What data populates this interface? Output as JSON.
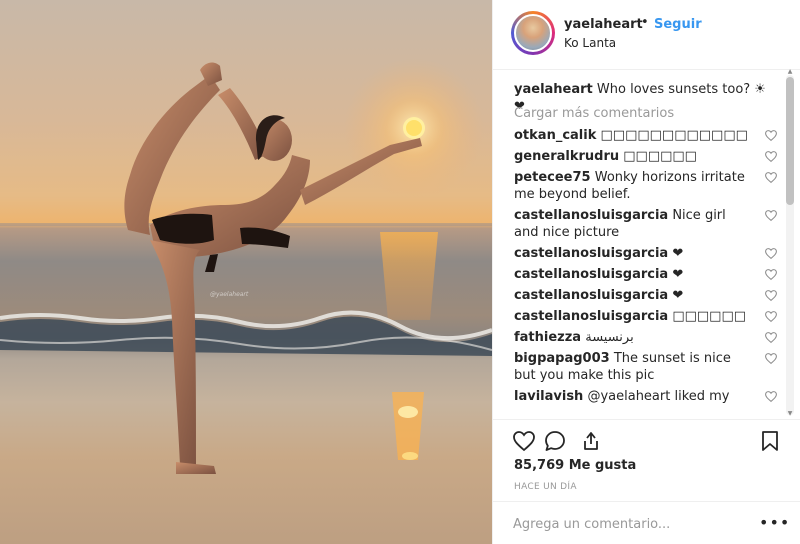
{
  "post": {
    "username": "yaelaheart",
    "follow_label": "Seguir",
    "separator": "•",
    "location": "Ko Lanta",
    "watermark": "@yaelaheart"
  },
  "caption": {
    "username": "yaelaheart",
    "text": "Who loves sunsets too? ☀ ❤"
  },
  "load_more_label": "Cargar más comentarios",
  "comments": [
    {
      "user": "otkan_calik",
      "text": "□□□□□□□□□□□□"
    },
    {
      "user": "generalkrudru",
      "text": "□□□□□□"
    },
    {
      "user": "petecee75",
      "text": "Wonky horizons irritate me beyond belief."
    },
    {
      "user": "castellanosluisgarcia",
      "text": "Nice girl and nice picture"
    },
    {
      "user": "castellanosluisgarcia",
      "text": "❤"
    },
    {
      "user": "castellanosluisgarcia",
      "text": "❤"
    },
    {
      "user": "castellanosluisgarcia",
      "text": "❤"
    },
    {
      "user": "castellanosluisgarcia",
      "text": "□□□□□□"
    },
    {
      "user": "fathiezza",
      "text": "برنسيسة"
    },
    {
      "user": "bigpapag003",
      "text": "The sunset is nice but you make this pic"
    },
    {
      "user": "lavilavish",
      "text": "@yaelaheart liked my"
    }
  ],
  "likes_label": "85,769 Me gusta",
  "timestamp": "HACE UN DÍA",
  "add_comment": {
    "placeholder": "Agrega un comentario..."
  },
  "more_label": "•••",
  "icons": {
    "like": "heart-icon",
    "comment": "comment-bubble-icon",
    "share": "share-icon",
    "save": "bookmark-icon"
  },
  "colors": {
    "follow": "#3897f0",
    "muted": "#999999",
    "text": "#262626"
  }
}
